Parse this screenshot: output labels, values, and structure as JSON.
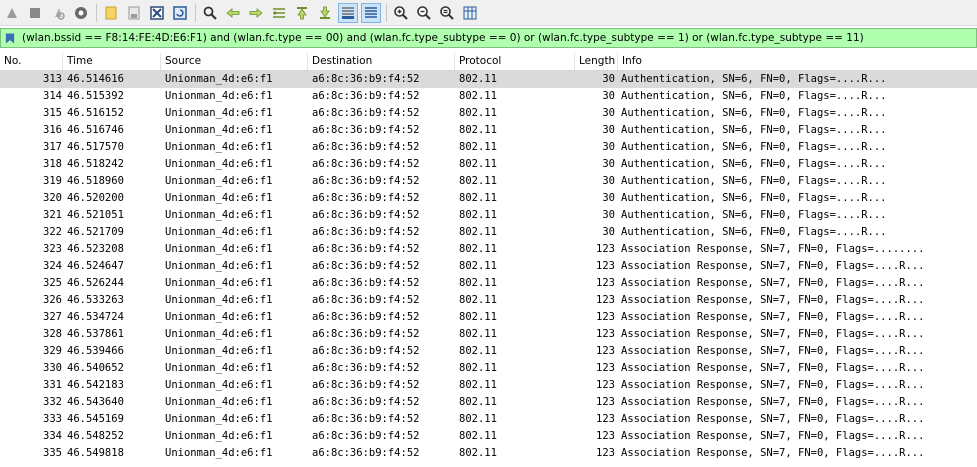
{
  "toolbar": {
    "icons": [
      "shark-fin-start-icon",
      "stop-capture-icon",
      "restart-capture-icon",
      "capture-options-icon",
      "open-file-icon",
      "save-file-icon",
      "close-file-icon",
      "reload-file-icon",
      "find-packet-icon",
      "go-back-icon",
      "go-forward-icon",
      "go-to-packet-icon",
      "first-packet-icon",
      "last-packet-icon",
      "autoscroll-icon",
      "colorize-icon",
      "zoom-in-icon",
      "zoom-out-icon",
      "normal-size-icon",
      "resize-columns-icon"
    ]
  },
  "filter": {
    "text": "(wlan.bssid == F8:14:FE:4D:E6:F1) and (wlan.fc.type == 00) and (wlan.fc.type_subtype == 0) or (wlan.fc.type_subtype == 1) or (wlan.fc.type_subtype == 11)",
    "background": "#afffaf"
  },
  "columns": {
    "no": "No.",
    "time": "Time",
    "source": "Source",
    "destination": "Destination",
    "protocol": "Protocol",
    "length": "Length",
    "info": "Info"
  },
  "selected_row_index": 0,
  "packets": [
    {
      "no": "313",
      "time": "46.514616",
      "source": "Unionman_4d:e6:f1",
      "destination": "a6:8c:36:b9:f4:52",
      "protocol": "802.11",
      "length": "30",
      "info": "Authentication, SN=6, FN=0, Flags=....R..."
    },
    {
      "no": "314",
      "time": "46.515392",
      "source": "Unionman_4d:e6:f1",
      "destination": "a6:8c:36:b9:f4:52",
      "protocol": "802.11",
      "length": "30",
      "info": "Authentication, SN=6, FN=0, Flags=....R..."
    },
    {
      "no": "315",
      "time": "46.516152",
      "source": "Unionman_4d:e6:f1",
      "destination": "a6:8c:36:b9:f4:52",
      "protocol": "802.11",
      "length": "30",
      "info": "Authentication, SN=6, FN=0, Flags=....R..."
    },
    {
      "no": "316",
      "time": "46.516746",
      "source": "Unionman_4d:e6:f1",
      "destination": "a6:8c:36:b9:f4:52",
      "protocol": "802.11",
      "length": "30",
      "info": "Authentication, SN=6, FN=0, Flags=....R..."
    },
    {
      "no": "317",
      "time": "46.517570",
      "source": "Unionman_4d:e6:f1",
      "destination": "a6:8c:36:b9:f4:52",
      "protocol": "802.11",
      "length": "30",
      "info": "Authentication, SN=6, FN=0, Flags=....R..."
    },
    {
      "no": "318",
      "time": "46.518242",
      "source": "Unionman_4d:e6:f1",
      "destination": "a6:8c:36:b9:f4:52",
      "protocol": "802.11",
      "length": "30",
      "info": "Authentication, SN=6, FN=0, Flags=....R..."
    },
    {
      "no": "319",
      "time": "46.518960",
      "source": "Unionman_4d:e6:f1",
      "destination": "a6:8c:36:b9:f4:52",
      "protocol": "802.11",
      "length": "30",
      "info": "Authentication, SN=6, FN=0, Flags=....R..."
    },
    {
      "no": "320",
      "time": "46.520200",
      "source": "Unionman_4d:e6:f1",
      "destination": "a6:8c:36:b9:f4:52",
      "protocol": "802.11",
      "length": "30",
      "info": "Authentication, SN=6, FN=0, Flags=....R..."
    },
    {
      "no": "321",
      "time": "46.521051",
      "source": "Unionman_4d:e6:f1",
      "destination": "a6:8c:36:b9:f4:52",
      "protocol": "802.11",
      "length": "30",
      "info": "Authentication, SN=6, FN=0, Flags=....R..."
    },
    {
      "no": "322",
      "time": "46.521709",
      "source": "Unionman_4d:e6:f1",
      "destination": "a6:8c:36:b9:f4:52",
      "protocol": "802.11",
      "length": "30",
      "info": "Authentication, SN=6, FN=0, Flags=....R..."
    },
    {
      "no": "323",
      "time": "46.523208",
      "source": "Unionman_4d:e6:f1",
      "destination": "a6:8c:36:b9:f4:52",
      "protocol": "802.11",
      "length": "123",
      "info": "Association Response, SN=7, FN=0, Flags=........"
    },
    {
      "no": "324",
      "time": "46.524647",
      "source": "Unionman_4d:e6:f1",
      "destination": "a6:8c:36:b9:f4:52",
      "protocol": "802.11",
      "length": "123",
      "info": "Association Response, SN=7, FN=0, Flags=....R..."
    },
    {
      "no": "325",
      "time": "46.526244",
      "source": "Unionman_4d:e6:f1",
      "destination": "a6:8c:36:b9:f4:52",
      "protocol": "802.11",
      "length": "123",
      "info": "Association Response, SN=7, FN=0, Flags=....R..."
    },
    {
      "no": "326",
      "time": "46.533263",
      "source": "Unionman_4d:e6:f1",
      "destination": "a6:8c:36:b9:f4:52",
      "protocol": "802.11",
      "length": "123",
      "info": "Association Response, SN=7, FN=0, Flags=....R..."
    },
    {
      "no": "327",
      "time": "46.534724",
      "source": "Unionman_4d:e6:f1",
      "destination": "a6:8c:36:b9:f4:52",
      "protocol": "802.11",
      "length": "123",
      "info": "Association Response, SN=7, FN=0, Flags=....R..."
    },
    {
      "no": "328",
      "time": "46.537861",
      "source": "Unionman_4d:e6:f1",
      "destination": "a6:8c:36:b9:f4:52",
      "protocol": "802.11",
      "length": "123",
      "info": "Association Response, SN=7, FN=0, Flags=....R..."
    },
    {
      "no": "329",
      "time": "46.539466",
      "source": "Unionman_4d:e6:f1",
      "destination": "a6:8c:36:b9:f4:52",
      "protocol": "802.11",
      "length": "123",
      "info": "Association Response, SN=7, FN=0, Flags=....R..."
    },
    {
      "no": "330",
      "time": "46.540652",
      "source": "Unionman_4d:e6:f1",
      "destination": "a6:8c:36:b9:f4:52",
      "protocol": "802.11",
      "length": "123",
      "info": "Association Response, SN=7, FN=0, Flags=....R..."
    },
    {
      "no": "331",
      "time": "46.542183",
      "source": "Unionman_4d:e6:f1",
      "destination": "a6:8c:36:b9:f4:52",
      "protocol": "802.11",
      "length": "123",
      "info": "Association Response, SN=7, FN=0, Flags=....R..."
    },
    {
      "no": "332",
      "time": "46.543640",
      "source": "Unionman_4d:e6:f1",
      "destination": "a6:8c:36:b9:f4:52",
      "protocol": "802.11",
      "length": "123",
      "info": "Association Response, SN=7, FN=0, Flags=....R..."
    },
    {
      "no": "333",
      "time": "46.545169",
      "source": "Unionman_4d:e6:f1",
      "destination": "a6:8c:36:b9:f4:52",
      "protocol": "802.11",
      "length": "123",
      "info": "Association Response, SN=7, FN=0, Flags=....R..."
    },
    {
      "no": "334",
      "time": "46.548252",
      "source": "Unionman_4d:e6:f1",
      "destination": "a6:8c:36:b9:f4:52",
      "protocol": "802.11",
      "length": "123",
      "info": "Association Response, SN=7, FN=0, Flags=....R..."
    },
    {
      "no": "335",
      "time": "46.549818",
      "source": "Unionman_4d:e6:f1",
      "destination": "a6:8c:36:b9:f4:52",
      "protocol": "802.11",
      "length": "123",
      "info": "Association Response, SN=7, FN=0, Flags=....R..."
    }
  ]
}
